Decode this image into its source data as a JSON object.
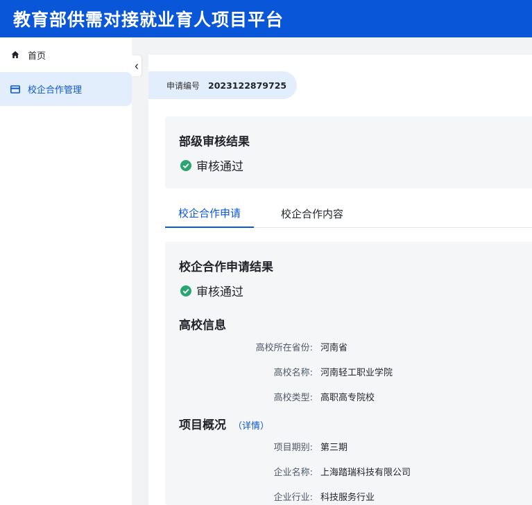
{
  "header": {
    "title": "教育部供需对接就业育人项目平台"
  },
  "sidebar": {
    "items": [
      {
        "label": "首页",
        "icon": "home-icon"
      },
      {
        "label": "校企合作管理",
        "icon": "card-icon"
      }
    ],
    "active_index": 1
  },
  "application": {
    "number_label": "申请编号",
    "number_value": "2023122879725"
  },
  "ministry_review": {
    "title": "部级审核结果",
    "status": "审核通过"
  },
  "tabs": [
    {
      "label": "校企合作申请"
    },
    {
      "label": "校企合作内容"
    }
  ],
  "cooperation": {
    "title": "校企合作申请结果",
    "status": "审核通过",
    "school": {
      "title": "高校信息",
      "fields": [
        {
          "label": "高校所在省份:",
          "value": "河南省"
        },
        {
          "label": "高校名称:",
          "value": "河南轻工职业学院"
        },
        {
          "label": "高校类型:",
          "value": "高职高专院校"
        }
      ]
    },
    "project": {
      "title": "项目概况",
      "detail_link": "（详情）",
      "fields": [
        {
          "label": "项目期别:",
          "value": "第三期"
        },
        {
          "label": "企业名称:",
          "value": "上海踏瑞科技有限公司"
        },
        {
          "label": "企业行业:",
          "value": "科技服务行业"
        }
      ]
    }
  },
  "colors": {
    "brand": "#0a56d8",
    "active_bg": "#e3eefc",
    "success": "#2ba471"
  }
}
